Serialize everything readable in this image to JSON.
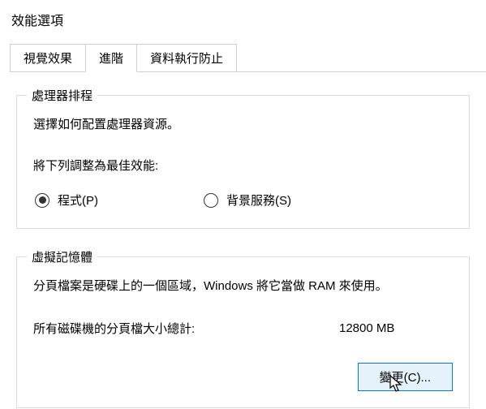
{
  "window_title": "效能選項",
  "tabs": {
    "visual": "視覺效果",
    "advanced": "進階",
    "dep": "資料執行防止",
    "active_index": 1
  },
  "cpu_group": {
    "legend": "處理器排程",
    "desc": "選擇如何配置處理器資源。",
    "adjust_label": "將下列調整為最佳效能:",
    "option_programs": "程式(P)",
    "option_services": "背景服務(S)",
    "selected": "programs"
  },
  "vm_group": {
    "legend": "虛擬記憶體",
    "desc": "分頁檔案是硬碟上的一個區域，Windows 將它當做 RAM 來使用。",
    "total_label": "所有磁碟機的分頁檔大小總計:",
    "total_value": "12800 MB",
    "change_button": "變更(C)..."
  }
}
